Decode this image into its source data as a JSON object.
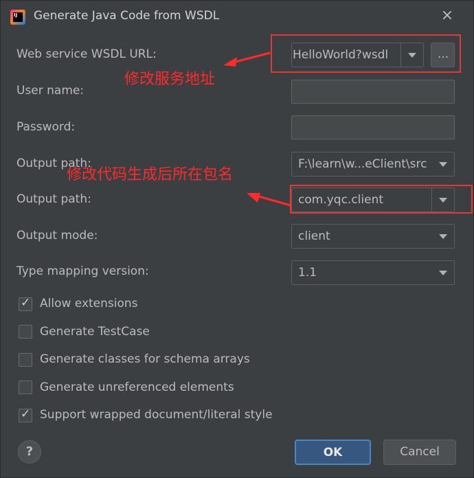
{
  "title": "Generate Java Code from WSDL",
  "app_icon": "IJ",
  "close_icon": "×",
  "fields": {
    "wsdl_label": "Web service WSDL URL:",
    "wsdl_value": "HelloWorld?wsdl",
    "browse_label": "...",
    "user_label": "User name:",
    "user_value": "",
    "password_label": "Password:",
    "password_value": "",
    "output_path_label": "Output path:",
    "output_path_value": "F:\\learn\\w...eClient\\src",
    "package_label": "Output path:",
    "package_value": "com.yqc.client",
    "mode_label": "Output mode:",
    "mode_value": "client",
    "type_mapping_label": "Type mapping version:",
    "type_mapping_value": "1.1"
  },
  "annotations": {
    "note1": "修改服务地址",
    "note2": "修改代码生成后所在包名"
  },
  "options": [
    {
      "label": "Allow extensions",
      "checked": true
    },
    {
      "label": "Generate TestCase",
      "checked": false
    },
    {
      "label": "Generate classes for schema arrays",
      "checked": false
    },
    {
      "label": "Generate unreferenced elements",
      "checked": false
    },
    {
      "label": "Support wrapped document/literal style",
      "checked": true
    }
  ],
  "buttons": {
    "help": "?",
    "ok": "OK",
    "cancel": "Cancel"
  },
  "colors": {
    "background": "#3c3f41",
    "annotation": "#ff2a2a",
    "ok_button": "#365880"
  }
}
